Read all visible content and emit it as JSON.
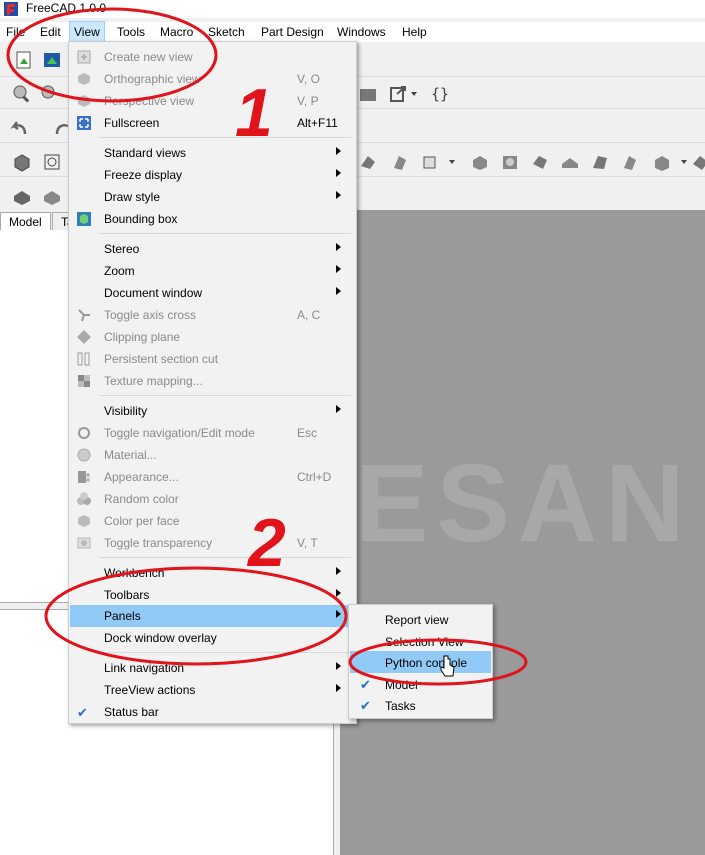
{
  "window": {
    "title": "FreeCAD 1.0.0"
  },
  "menubar": [
    {
      "key": "file",
      "label": "File"
    },
    {
      "key": "edit",
      "label": "Edit"
    },
    {
      "key": "view",
      "label": "View",
      "active": true
    },
    {
      "key": "tools",
      "label": "Tools"
    },
    {
      "key": "macro",
      "label": "Macro"
    },
    {
      "key": "sketch",
      "label": "Sketch"
    },
    {
      "key": "partdesign",
      "label": "Part Design"
    },
    {
      "key": "windows",
      "label": "Windows"
    },
    {
      "key": "help",
      "label": "Help"
    }
  ],
  "tabs": {
    "model": "Model",
    "tasks": "Ta"
  },
  "view_menu": {
    "create_new_view": {
      "label": "Create new view",
      "disabled": true,
      "icon": "new-view-icon"
    },
    "orthographic_view": {
      "label": "Orthographic view",
      "shortcut": "V, O",
      "disabled": true,
      "icon": "cube-icon"
    },
    "perspective_view": {
      "label": "Perspective view",
      "shortcut": "V, P",
      "disabled": true,
      "icon": "cube-icon"
    },
    "fullscreen": {
      "label": "Fullscreen",
      "shortcut": "Alt+F11",
      "icon": "fullscreen-icon"
    },
    "standard_views": {
      "label": "Standard views"
    },
    "freeze_display": {
      "label": "Freeze display"
    },
    "draw_style": {
      "label": "Draw style"
    },
    "bounding_box": {
      "label": "Bounding box",
      "icon": "bounding-box-icon"
    },
    "stereo": {
      "label": "Stereo"
    },
    "zoom": {
      "label": "Zoom"
    },
    "document_window": {
      "label": "Document window"
    },
    "toggle_axis_cross": {
      "label": "Toggle axis cross",
      "shortcut": "A, C",
      "disabled": true,
      "icon": "axis-cross-icon"
    },
    "clipping_plane": {
      "label": "Clipping plane",
      "disabled": true,
      "icon": "clipping-plane-icon"
    },
    "persistent_section_cut": {
      "label": "Persistent section cut",
      "disabled": true,
      "icon": "section-cut-icon"
    },
    "texture_mapping": {
      "label": "Texture mapping...",
      "disabled": true,
      "icon": "texture-icon"
    },
    "visibility": {
      "label": "Visibility"
    },
    "toggle_navigation": {
      "label": "Toggle navigation/Edit mode",
      "shortcut": "Esc",
      "disabled": true,
      "icon": "navigation-icon"
    },
    "material": {
      "label": "Material...",
      "disabled": true,
      "icon": "material-icon"
    },
    "appearance": {
      "label": "Appearance...",
      "shortcut": "Ctrl+D",
      "disabled": true,
      "icon": "appearance-icon"
    },
    "random_color": {
      "label": "Random color",
      "disabled": true,
      "icon": "random-color-icon"
    },
    "color_per_face": {
      "label": "Color per face",
      "disabled": true,
      "icon": "color-per-face-icon"
    },
    "toggle_transparency": {
      "label": "Toggle transparency",
      "shortcut": "V, T",
      "disabled": true,
      "icon": "transparency-icon"
    },
    "workbench": {
      "label": "Workbench"
    },
    "toolbars": {
      "label": "Toolbars"
    },
    "panels": {
      "label": "Panels",
      "highlighted": true
    },
    "dock_window_overlay": {
      "label": "Dock window overlay"
    },
    "link_navigation": {
      "label": "Link navigation"
    },
    "treeview_actions": {
      "label": "TreeView actions"
    },
    "status_bar": {
      "label": "Status bar",
      "checked": true
    }
  },
  "panels_menu": {
    "report_view": {
      "label": "Report view",
      "checked": false
    },
    "selection_view": {
      "label": "Selection View",
      "checked": false
    },
    "python_console": {
      "label": "Python console",
      "checked": false,
      "highlighted": true
    },
    "model": {
      "label": "Model",
      "checked": true
    },
    "tasks": {
      "label": "Tasks",
      "checked": true
    }
  },
  "annotations": {
    "step1": "1",
    "step2": "2"
  },
  "colors": {
    "highlight": "#91c9f7",
    "annotation": "#e0141a",
    "viewport": "#9a9a9a"
  }
}
